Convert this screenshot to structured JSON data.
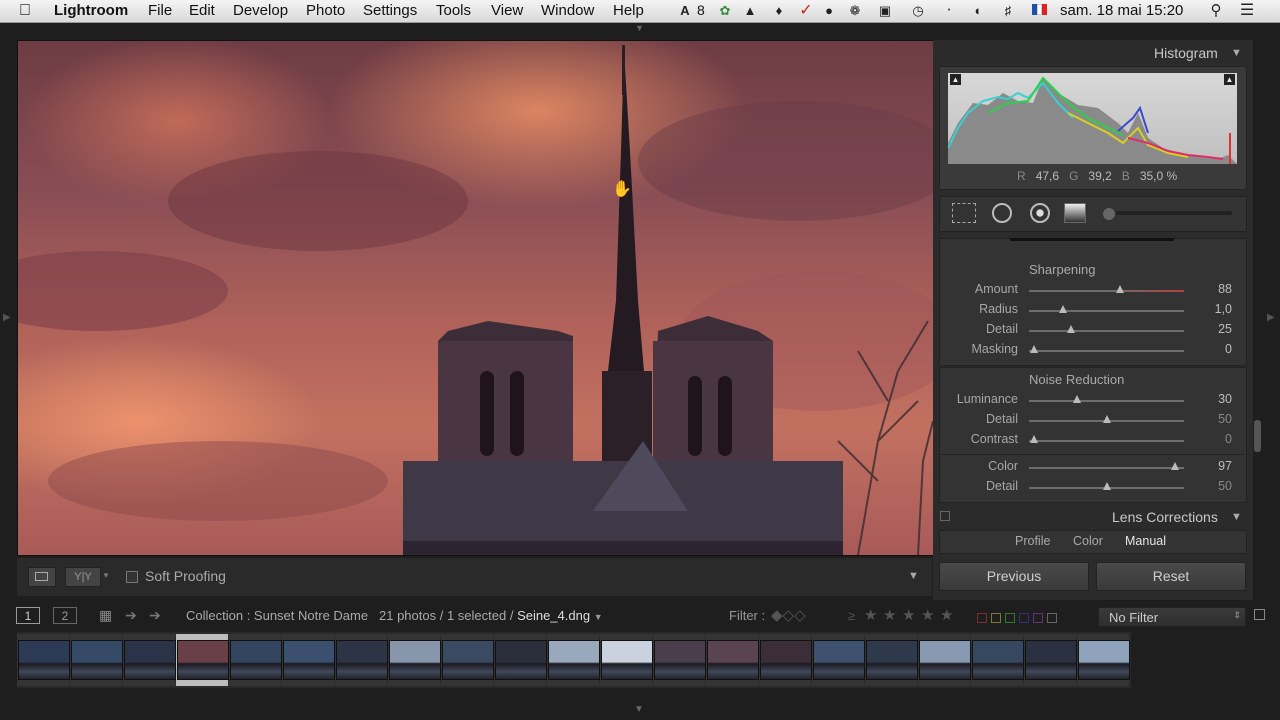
{
  "menubar": {
    "app": "Lightroom",
    "items": [
      "File",
      "Edit",
      "Develop",
      "Photo",
      "Settings",
      "Tools",
      "View",
      "Window",
      "Help"
    ],
    "notif_count": "8",
    "datetime": "sam. 18 mai  15:20"
  },
  "histogram": {
    "title": "Histogram",
    "r_label": "R",
    "r_value": "47,6",
    "g_label": "G",
    "g_value": "39,2",
    "b_label": "B",
    "b_value": "35,0",
    "unit": "%"
  },
  "sharpening": {
    "title": "Sharpening",
    "sliders": [
      {
        "label": "Amount",
        "value": "88",
        "fraction": 0.59
      },
      {
        "label": "Radius",
        "value": "1,0",
        "fraction": 0.22
      },
      {
        "label": "Detail",
        "value": "25",
        "fraction": 0.27
      },
      {
        "label": "Masking",
        "value": "0",
        "fraction": 0.03
      }
    ]
  },
  "noise": {
    "title": "Noise Reduction",
    "sliders": [
      {
        "label": "Luminance",
        "value": "30",
        "fraction": 0.31
      },
      {
        "label": "Detail",
        "value": "50",
        "fraction": 0.5
      },
      {
        "label": "Contrast",
        "value": "0",
        "fraction": 0.03
      },
      {
        "label": "Color",
        "value": "97",
        "fraction": 0.94
      },
      {
        "label": "Detail",
        "value": "50",
        "fraction": 0.5
      }
    ]
  },
  "lens": {
    "title": "Lens Corrections",
    "tabs": [
      "Profile",
      "Color",
      "Manual"
    ],
    "active_tab": "Manual"
  },
  "buttons": {
    "previous": "Previous",
    "reset": "Reset"
  },
  "toolbar": {
    "soft_proofing": "Soft Proofing"
  },
  "filmbar": {
    "view1": "1",
    "view2": "2",
    "collection": "Collection : Sunset Notre Dame",
    "count": "21 photos / 1 selected /",
    "filename": "Seine_4.dng",
    "filter_label": "Filter :",
    "filter_value": "No Filter"
  },
  "filmstrip": {
    "count": 21,
    "selected_index": 3
  },
  "colors": {
    "accent": "#cc3333",
    "panel": "#2b2b2b"
  }
}
